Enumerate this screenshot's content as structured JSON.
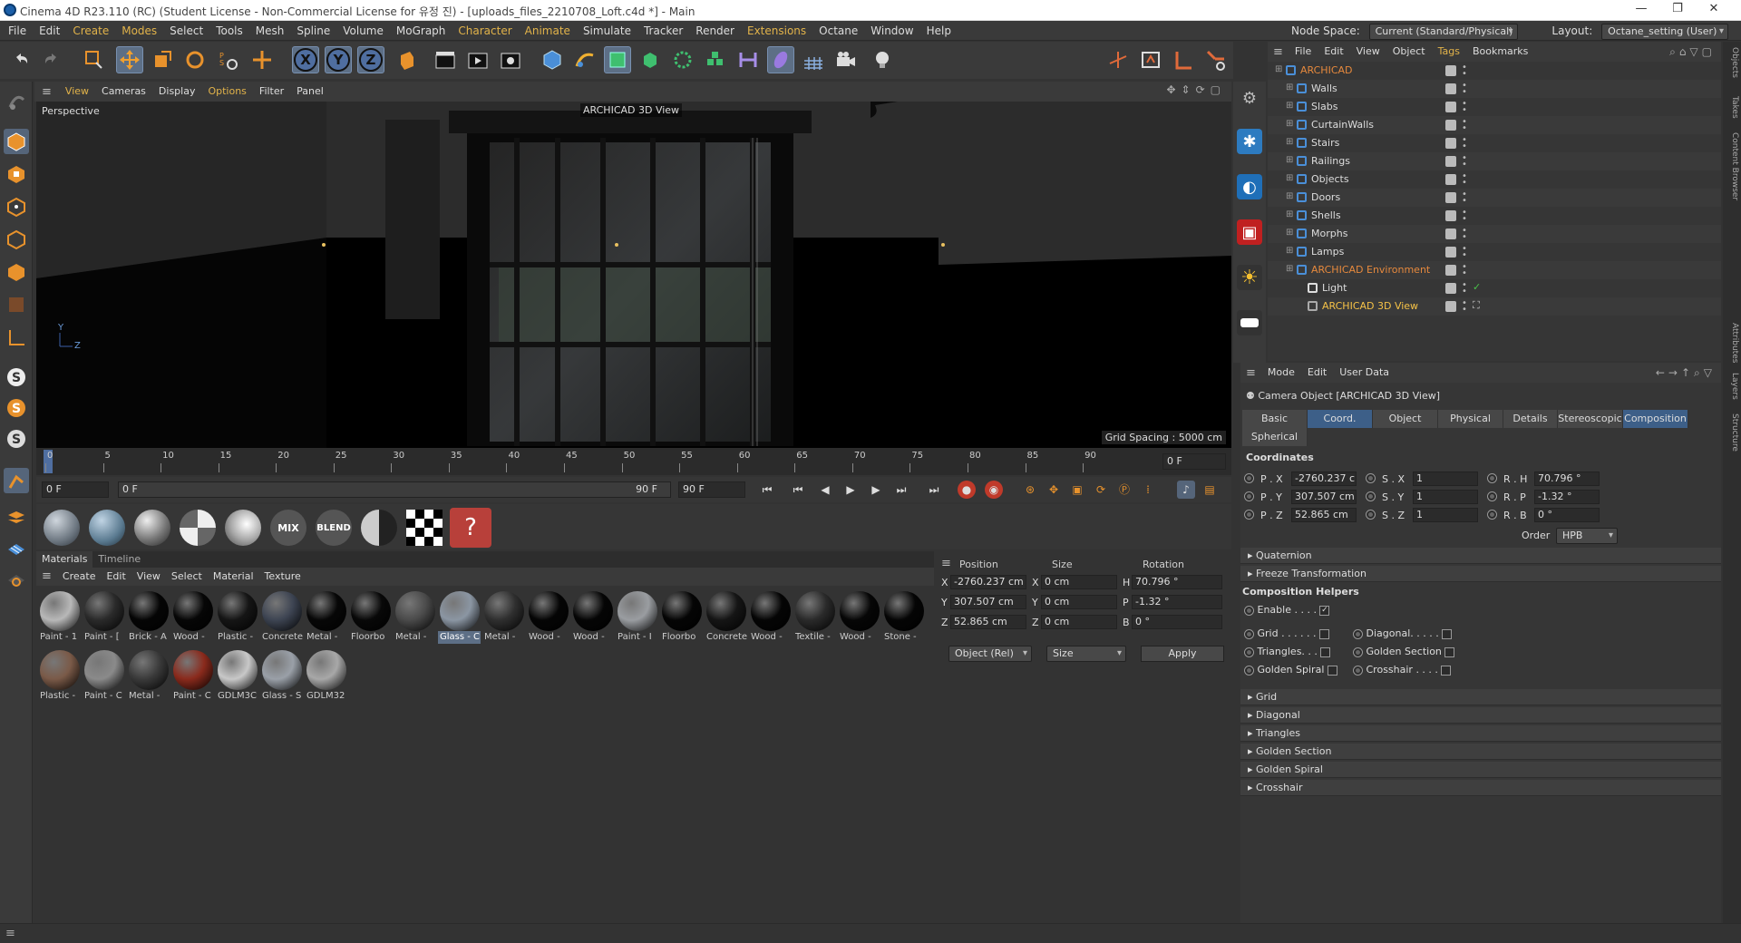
{
  "window": {
    "title": "Cinema 4D R23.110 (RC) (Student License - Non-Commercial License for 유정 진) - [uploads_files_2210708_Loft.c4d *] - Main",
    "controls": [
      "—",
      "❐",
      "✕"
    ]
  },
  "menubar": {
    "items": [
      "File",
      "Edit",
      "Create",
      "Modes",
      "Select",
      "Tools",
      "Mesh",
      "Spline",
      "Volume",
      "MoGraph",
      "Character",
      "Animate",
      "Simulate",
      "Tracker",
      "Render",
      "Extensions",
      "Octane",
      "Window",
      "Help"
    ],
    "node_space_label": "Node Space:",
    "node_space_value": "Current (Standard/Physical)",
    "layout_label": "Layout:",
    "layout_value": "Octane_setting (User)"
  },
  "toolbar": {
    "axis_x": "X",
    "axis_y": "Y",
    "axis_z": "Z"
  },
  "viewport": {
    "menu": [
      "View",
      "Cameras",
      "Display",
      "Options",
      "Filter",
      "Panel"
    ],
    "label": "Perspective",
    "camera_label": "ARCHICAD 3D View",
    "grid_spacing": "Grid Spacing : 5000 cm",
    "axis_y": "Y",
    "axis_z": "Z"
  },
  "timeline": {
    "ticks": [
      "0",
      "5",
      "10",
      "15",
      "20",
      "25",
      "30",
      "35",
      "40",
      "45",
      "50",
      "55",
      "60",
      "65",
      "70",
      "75",
      "80",
      "85",
      "90"
    ],
    "current_frame": "0 F"
  },
  "transport": {
    "start": "0 F",
    "range_start": "0 F",
    "range_end": "90 F",
    "end": "90 F"
  },
  "shelf": {
    "mix_label": "MIX",
    "blend_label": "BLEND"
  },
  "materials": {
    "tabs": [
      "Materials",
      "Timeline"
    ],
    "menu": [
      "Create",
      "Edit",
      "View",
      "Select",
      "Material",
      "Texture"
    ],
    "items": [
      {
        "label": "Paint - 1",
        "color": "#b8b8b8"
      },
      {
        "label": "Paint - [",
        "color": "#2a2a2a"
      },
      {
        "label": "Brick - A",
        "color": "#050505"
      },
      {
        "label": "Wood -",
        "color": "#060606"
      },
      {
        "label": "Plastic -",
        "color": "#151515"
      },
      {
        "label": "Concrete",
        "color": "#3d4452"
      },
      {
        "label": "Metal -",
        "color": "#070707"
      },
      {
        "label": "Floorbo",
        "color": "#080808"
      },
      {
        "label": "Metal -",
        "color": "#4a4a4a"
      },
      {
        "label": "Glass - C",
        "color": "#8b96a3"
      },
      {
        "label": "Metal -",
        "color": "#2f2f2f"
      },
      {
        "label": "Wood -",
        "color": "#050505"
      },
      {
        "label": "Wood -",
        "color": "#050505"
      },
      {
        "label": "Paint - I",
        "color": "#9a9da1"
      },
      {
        "label": "Floorbo",
        "color": "#050505"
      },
      {
        "label": "Concrete",
        "color": "#151515"
      },
      {
        "label": "Wood -",
        "color": "#050505"
      },
      {
        "label": "Textile -",
        "color": "#2a2a2a"
      },
      {
        "label": "Wood -",
        "color": "#060606"
      },
      {
        "label": "Stone -",
        "color": "#050505"
      },
      {
        "label": "Plastic -",
        "color": "#7a5a48"
      },
      {
        "label": "Paint - C",
        "color": "#8a8a8a"
      },
      {
        "label": "Metal -",
        "color": "#3a3a3a"
      },
      {
        "label": "Paint - C",
        "color": "#8a2a1c"
      },
      {
        "label": "GDLM3C",
        "color": "#c8c8c8"
      },
      {
        "label": "Glass - S",
        "color": "#9aa0a8"
      },
      {
        "label": "GDLM32",
        "color": "#a8a8a8"
      }
    ],
    "selected_index": 9
  },
  "coords": {
    "headers": [
      "Position",
      "Size",
      "Rotation"
    ],
    "rows": [
      {
        "axis": "X",
        "pos": "-2760.237 cm",
        "size_axis": "X",
        "size": "0 cm",
        "rot_axis": "H",
        "rot": "70.796 °"
      },
      {
        "axis": "Y",
        "pos": "307.507 cm",
        "size_axis": "Y",
        "size": "0 cm",
        "rot_axis": "P",
        "rot": "-1.32 °"
      },
      {
        "axis": "Z",
        "pos": "52.865 cm",
        "size_axis": "Z",
        "size": "0 cm",
        "rot_axis": "B",
        "rot": "0 °"
      }
    ],
    "mode": "Object (Rel)",
    "size_mode": "Size",
    "apply": "Apply"
  },
  "objects": {
    "menu": [
      "File",
      "Edit",
      "View",
      "Object",
      "Tags",
      "Bookmarks"
    ],
    "items": [
      {
        "name": "ARCHICAD",
        "indent": 0,
        "color": "or"
      },
      {
        "name": "Walls",
        "indent": 1,
        "color": ""
      },
      {
        "name": "Slabs",
        "indent": 1,
        "color": ""
      },
      {
        "name": "CurtainWalls",
        "indent": 1,
        "color": ""
      },
      {
        "name": "Stairs",
        "indent": 1,
        "color": ""
      },
      {
        "name": "Railings",
        "indent": 1,
        "color": ""
      },
      {
        "name": "Objects",
        "indent": 1,
        "color": ""
      },
      {
        "name": "Doors",
        "indent": 1,
        "color": ""
      },
      {
        "name": "Shells",
        "indent": 1,
        "color": ""
      },
      {
        "name": "Morphs",
        "indent": 1,
        "color": ""
      },
      {
        "name": "Lamps",
        "indent": 1,
        "color": ""
      },
      {
        "name": "ARCHICAD Environment",
        "indent": 1,
        "color": "or"
      },
      {
        "name": "Light",
        "indent": 2,
        "color": ""
      },
      {
        "name": "ARCHICAD 3D View",
        "indent": 2,
        "color": "yl"
      }
    ]
  },
  "attributes": {
    "menu": [
      "Mode",
      "Edit",
      "User Data"
    ],
    "object_title": "Camera Object [ARCHICAD 3D View]",
    "tabs": [
      "Basic",
      "Coord.",
      "Object",
      "Physical",
      "Details",
      "Stereoscopic",
      "Composition"
    ],
    "tab2": "Spherical",
    "coord_title": "Coordinates",
    "p": [
      {
        "l": "P . X",
        "v": "-2760.237 c"
      },
      {
        "l": "P . Y",
        "v": "307.507 cm"
      },
      {
        "l": "P . Z",
        "v": "52.865 cm"
      }
    ],
    "s": [
      {
        "l": "S . X",
        "v": "1"
      },
      {
        "l": "S . Y",
        "v": "1"
      },
      {
        "l": "S . Z",
        "v": "1"
      }
    ],
    "r": [
      {
        "l": "R . H",
        "v": "70.796 °"
      },
      {
        "l": "R . P",
        "v": "-1.32 °"
      },
      {
        "l": "R . B",
        "v": "0 °"
      }
    ],
    "order_label": "Order",
    "order_value": "HPB",
    "quaternion": "Quaternion",
    "freeze": "Freeze Transformation",
    "helpers_title": "Composition Helpers",
    "enable": "Enable . . . .",
    "grid": "Grid . . . . . .",
    "diagonal": "Diagonal. . . . .",
    "triangles": "Triangles. . .",
    "golden_section": "Golden Section",
    "golden_spiral": "Golden Spiral",
    "crosshair": "Crosshair . . . .",
    "sections": [
      "Grid",
      "Diagonal",
      "Triangles",
      "Golden Section",
      "Golden Spiral",
      "Crosshair"
    ]
  },
  "side_tabs": [
    "Objects",
    "Takes",
    "Content Browser",
    "Attributes",
    "Layers",
    "Structure"
  ]
}
